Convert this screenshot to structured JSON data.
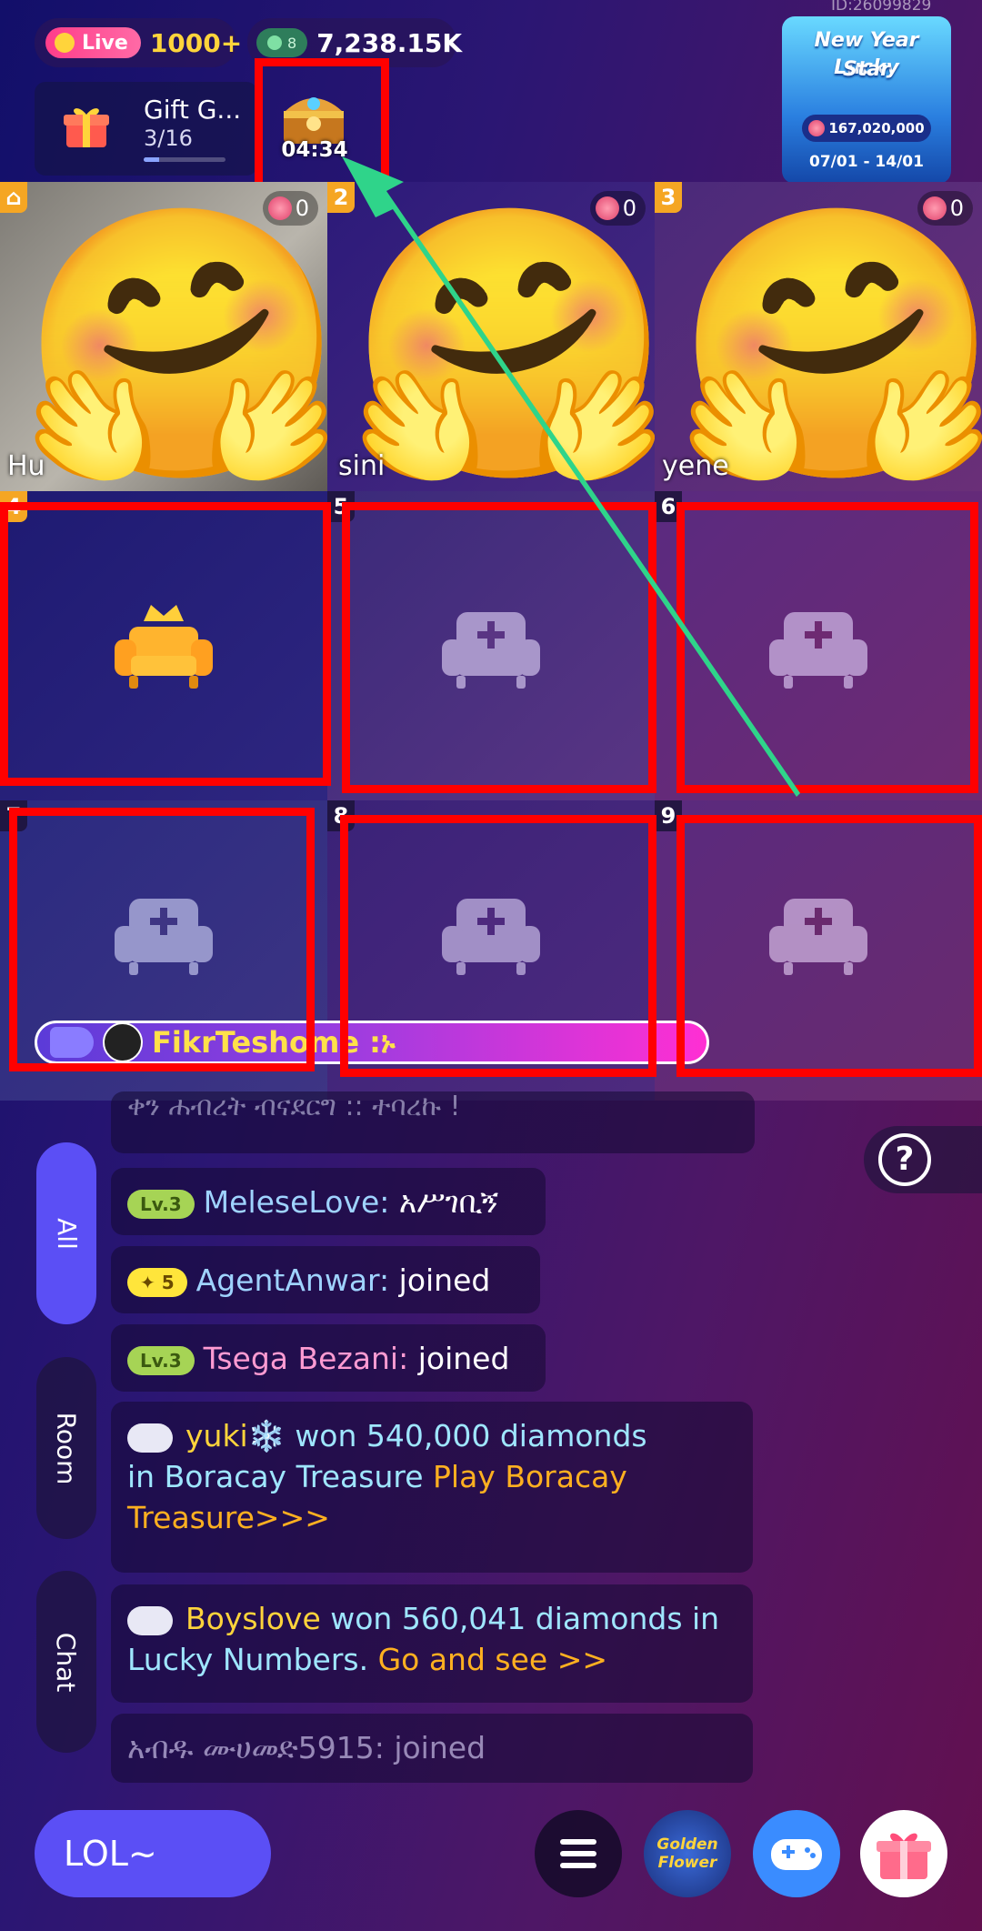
{
  "topbar": {
    "live_label": "Live",
    "live_count": "1000+",
    "coin_level": "8",
    "coins": "7,238.15K",
    "room_id": "ID:26099829"
  },
  "gift_goal": {
    "title": "Gift G...",
    "progress_text": "3/16",
    "progress_fraction": 0.1875,
    "timer": "04:34"
  },
  "banner": {
    "title_line1": "New Year Lucky",
    "title_line2": "Star",
    "pool": "167,020,000",
    "dates": "07/01 - 14/01"
  },
  "seats": [
    {
      "number": "",
      "name": "Hu",
      "hearts": "0",
      "occupied": true,
      "host": true
    },
    {
      "number": "2",
      "name": "sini",
      "hearts": "0",
      "occupied": true
    },
    {
      "number": "3",
      "name": "yene",
      "hearts": "0",
      "occupied": true
    },
    {
      "number": "4",
      "occupied": false,
      "crown": true
    },
    {
      "number": "5",
      "occupied": false
    },
    {
      "number": "6",
      "occupied": false
    },
    {
      "number": "7",
      "occupied": false
    },
    {
      "number": "8",
      "occupied": false
    },
    {
      "number": "9",
      "occupied": false
    }
  ],
  "notification": {
    "name": "FikrTeshome :ኑ"
  },
  "tabs": [
    "All",
    "Room",
    "Chat"
  ],
  "chat": {
    "partial_line": "ቀን ሐብረት ብናደርግ :: ተባረኩ !",
    "m1": {
      "badge": "Lv.3",
      "user": "MeleseLove:",
      "text": "አሥገቢኝ"
    },
    "m2": {
      "badge": "5",
      "user": "AgentAnwar:",
      "text": "joined"
    },
    "m3": {
      "badge": "Lv.3",
      "user": "Tsega Bezani:",
      "text": "joined"
    },
    "m4": {
      "user": "yuki❄️",
      "text1": "won 540,000 diamonds",
      "text2": "in Boracay Treasure",
      "link": "Play Boracay",
      "link2": "Treasure>>>"
    },
    "m5": {
      "user": "Boyslove",
      "text1": "won 560,041 diamonds in",
      "text2": "Lucky Numbers.",
      "link": "Go and see >>"
    },
    "m6": {
      "text": "አብዱ ሙሀመድ5915: joined"
    }
  },
  "help_label": "?",
  "input_placeholder": "LOL~",
  "golden_flower_label": "Golden Flower",
  "colors": {
    "accent": "#5b4ff5",
    "highlight": "#ff0000",
    "arrow": "#2fd48a"
  }
}
